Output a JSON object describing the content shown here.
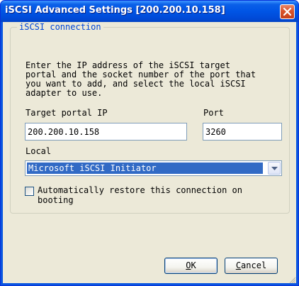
{
  "window": {
    "title": "iSCSI Advanced Settings [200.200.10.158]"
  },
  "group": {
    "legend": "iSCSI connection",
    "description": "Enter the IP address of the iSCSI target\nportal and the socket number of the port that\nyou want to add, and select the local iSCSI\nadapter to use."
  },
  "target_portal": {
    "label": "Target portal IP",
    "value": "200.200.10.158"
  },
  "port": {
    "label": "Port",
    "value": "3260"
  },
  "local": {
    "label": "Local",
    "selected": "Microsoft iSCSI Initiator"
  },
  "auto_restore": {
    "label": "Automatically restore this connection on\nbooting",
    "checked": false
  },
  "buttons": {
    "ok_mnemonic": "O",
    "ok_rest": "K",
    "cancel_mnemonic": "C",
    "cancel_rest": "ancel"
  },
  "icons": {
    "close": "close-icon",
    "dropdown": "chevron-down-icon"
  },
  "colors": {
    "title_bar": "#0055e5",
    "close_button": "#d9532c",
    "legend_text": "#0046d5",
    "selection": "#316ac5",
    "dialog_bg": "#ece9d8"
  }
}
